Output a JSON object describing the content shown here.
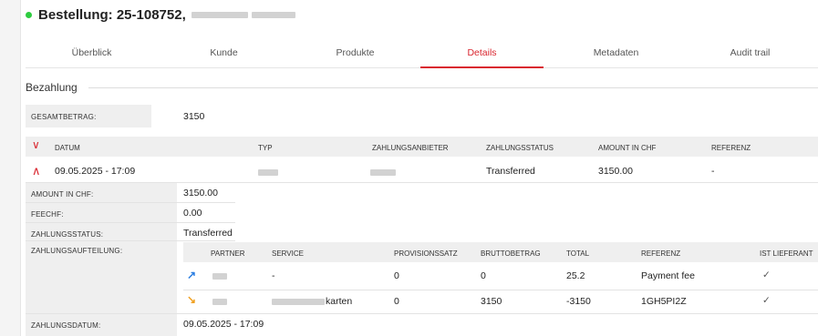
{
  "header": {
    "title": "Bestellung: 25-108752,"
  },
  "tabs": [
    "Überblick",
    "Kunde",
    "Produkte",
    "Details",
    "Metadaten",
    "Audit trail"
  ],
  "active_tab": "Details",
  "section": {
    "title": "Bezahlung"
  },
  "gesamtbetrag": {
    "label": "GESAMTBETRAG:",
    "value": "3150"
  },
  "payments_table": {
    "headers": [
      "DATUM",
      "TYP",
      "ZAHLUNGSANBIETER",
      "ZAHLUNGSSTATUS",
      "AMOUNT IN CHF",
      "REFERENZ"
    ],
    "row": {
      "datum": "09.05.2025 - 17:09",
      "status": "Transferred",
      "amount": "3150.00",
      "referenz": "-"
    }
  },
  "details": {
    "amount_label": "AMOUNT IN CHF:",
    "amount_value": "3150.00",
    "fee_label": "FEECHF:",
    "fee_value": "0.00",
    "status_label": "ZAHLUNGSSTATUS:",
    "status_value": "Transferred",
    "split_label": "ZAHLUNGSAUFTEILUNG:",
    "date_label": "ZAHLUNGSDATUM:",
    "date_value": "09.05.2025 - 17:09"
  },
  "split_table": {
    "headers": [
      "PARTNER",
      "SERVICE",
      "PROVISIONSSATZ",
      "BRUTTOBETRAG",
      "TOTAL",
      "REFERENZ",
      "IST LIEFERANT"
    ],
    "rows": [
      {
        "service": "-",
        "provision": "0",
        "brutto": "0",
        "total": "25.2",
        "referenz": "Payment fee",
        "lieferant": "✓"
      },
      {
        "service": "karten",
        "provision": "0",
        "brutto": "3150",
        "total": "-3150",
        "referenz": "1GH5PI2Z",
        "lieferant": "✓"
      }
    ]
  },
  "colors": {
    "accent": "#d9262f",
    "status_dot": "#2ecc40",
    "arrow_up": "#2a7de1",
    "arrow_down": "#f0a020"
  }
}
